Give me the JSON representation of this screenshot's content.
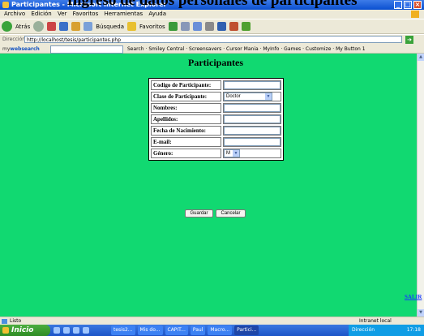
{
  "overlay_caption": "Ingreso de datos personales de participantes",
  "window": {
    "title": "Participantes - Microsoft Internet Explorer"
  },
  "menu": [
    "Archivo",
    "Edición",
    "Ver",
    "Favoritos",
    "Herramientas",
    "Ayuda"
  ],
  "toolbar": {
    "back": "Atrás",
    "search": "Búsqueda",
    "favorites": "Favoritos"
  },
  "address": {
    "label": "Dirección",
    "url": "http://localhost/tesis/participantes.php"
  },
  "links_bar": {
    "brand_prefix": "my",
    "brand_main": "websearch",
    "items": "Search  ·  Smiley Central  ·  Screensavers  ·  Cursor Mania  ·  MyInfo  ·  Games  ·  Customize  ·  My Button 1"
  },
  "page": {
    "title": "Participantes",
    "fields": [
      {
        "label": "Codigo de Participante:",
        "type": "text"
      },
      {
        "label": "Clase de Participante:",
        "type": "select",
        "value": "Doctor"
      },
      {
        "label": "Nombres:",
        "type": "text"
      },
      {
        "label": "Apellidos:",
        "type": "text"
      },
      {
        "label": "Fecha de Nacimiento:",
        "type": "text"
      },
      {
        "label": "E-mail:",
        "type": "text"
      },
      {
        "label": "Género:",
        "type": "select",
        "value": "M"
      }
    ],
    "save_label": "Guardar",
    "cancel_label": "Cancelar",
    "exit_link": "SALIR"
  },
  "statusbar": {
    "left": "Listo",
    "zone": "Intranet local"
  },
  "taskbar": {
    "start": "Inicio",
    "tasks": [
      "tesis2...",
      "Mis do...",
      "CAPIT...",
      "Paul",
      "Macro...",
      "Partici..."
    ],
    "tray": "Dirección",
    "clock": "17:18"
  },
  "colors": {
    "page_background": "#11d971",
    "title_bar": "#0a4fd0",
    "taskbar": "#1c54c8",
    "start_button": "#2e8c24",
    "link": "#1a3cff"
  }
}
